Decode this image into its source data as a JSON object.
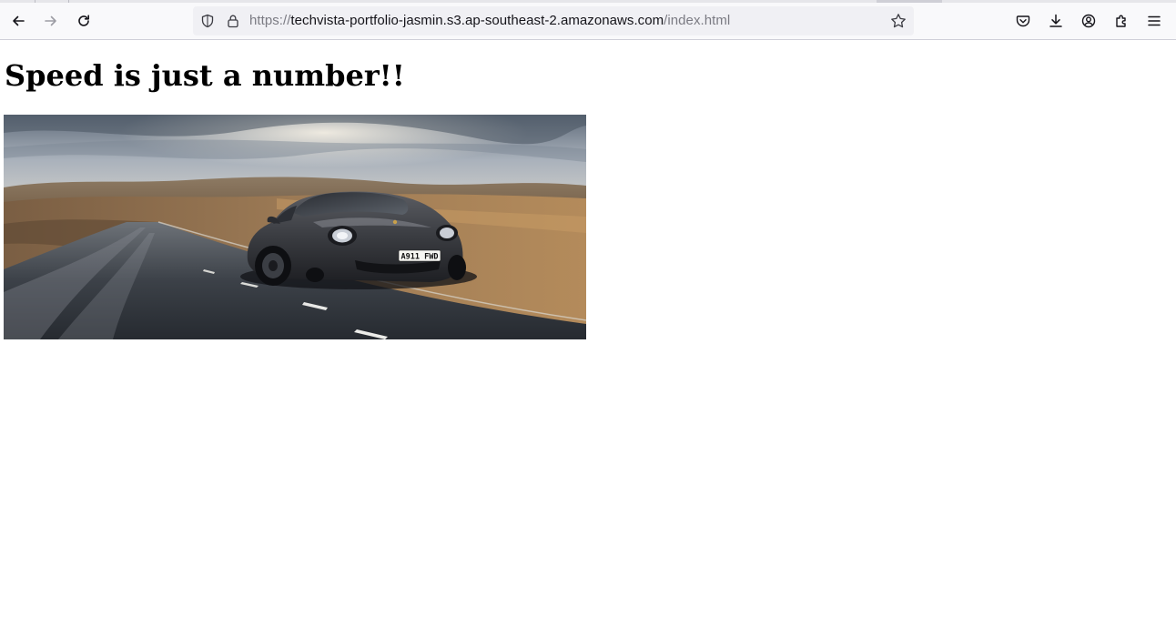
{
  "browser": {
    "address_bar": {
      "scheme": "https://",
      "host": "techvista-portfolio-jasmin.s3.ap-southeast-2.amazonaws.com",
      "path": "/index.html"
    },
    "icons": {
      "back": "back-arrow-icon",
      "forward": "forward-arrow-icon",
      "reload": "reload-icon",
      "tracking_protection": "shield-icon",
      "secure": "lock-icon",
      "bookmark": "star-icon",
      "pocket": "pocket-icon",
      "downloads": "download-icon",
      "account": "account-icon",
      "extensions": "extensions-icon",
      "menu": "hamburger-menu-icon"
    }
  },
  "page": {
    "heading": "Speed is just a number!!",
    "hero_image": {
      "subject": "dark grey sports car on a country road",
      "plate": "A911 FWD"
    }
  }
}
